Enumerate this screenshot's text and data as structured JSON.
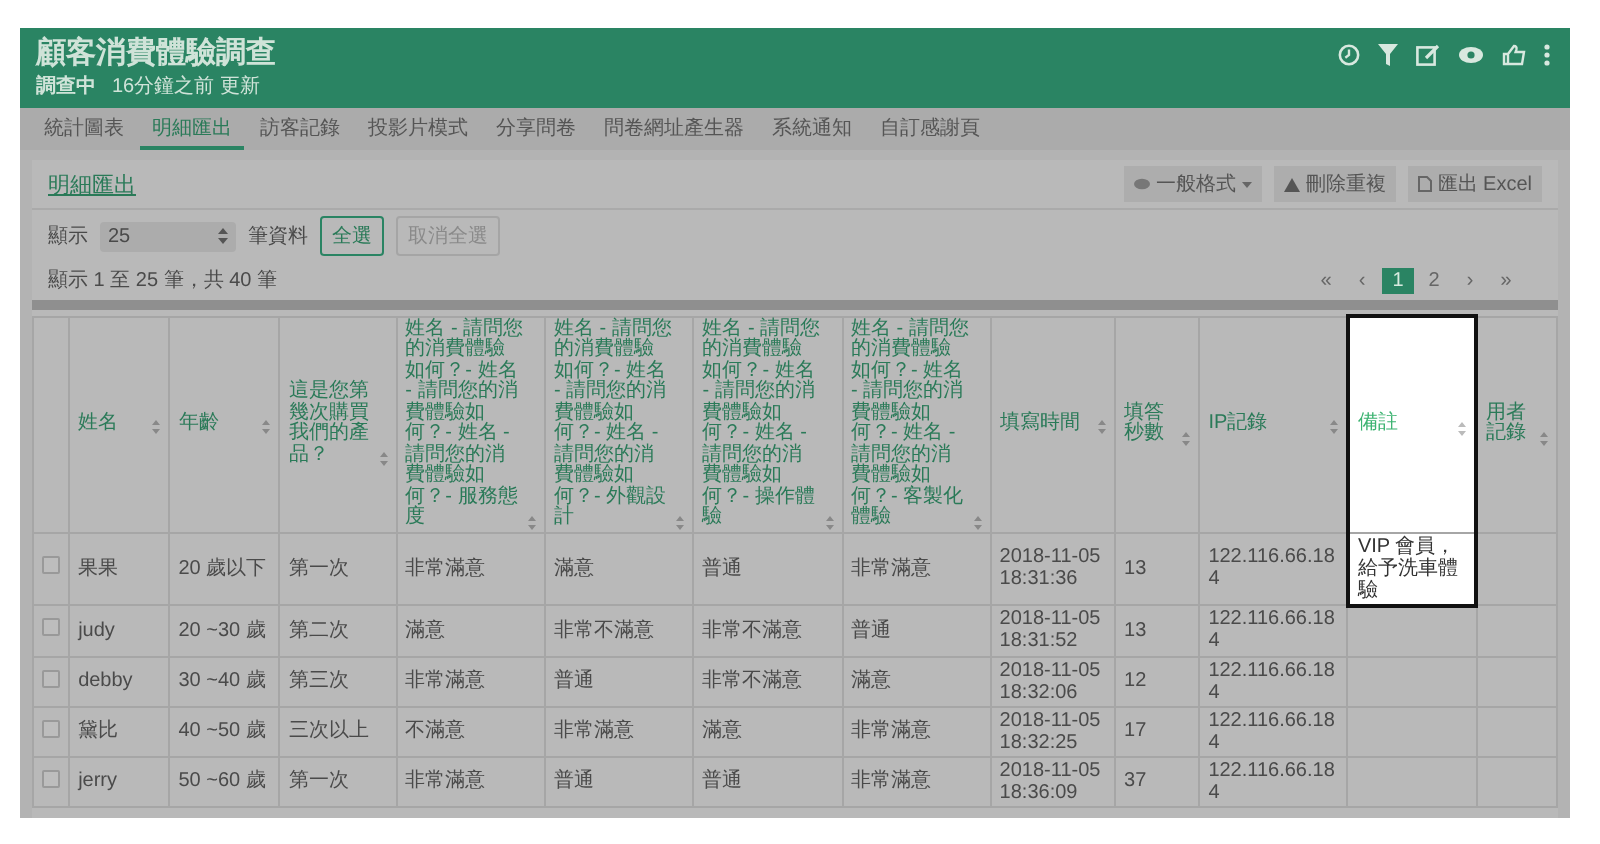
{
  "header": {
    "title": "顧客消費體驗調查",
    "status": "調查中",
    "updated": "16分鐘之前 更新"
  },
  "tabs": [
    {
      "label": "統計圖表",
      "selected": false
    },
    {
      "label": "明細匯出",
      "selected": true
    },
    {
      "label": "訪客記錄",
      "selected": false
    },
    {
      "label": "投影片模式",
      "selected": false
    },
    {
      "label": "分享問卷",
      "selected": false
    },
    {
      "label": "問卷網址產生器",
      "selected": false
    },
    {
      "label": "系統通知",
      "selected": false
    },
    {
      "label": "自訂感謝頁",
      "selected": false
    }
  ],
  "panel": {
    "title": "明細匯出",
    "tools": [
      {
        "kind": "format",
        "label": "一般格式"
      },
      {
        "kind": "dedupe",
        "label": "刪除重複"
      },
      {
        "kind": "export",
        "label": "匯出 Excel"
      }
    ]
  },
  "controls": {
    "show_label": "顯示",
    "page_size": "25",
    "unit_label": "筆資料",
    "buttons": [
      {
        "label": "全選",
        "disabled": false
      },
      {
        "label": "取消全選",
        "disabled": true
      }
    ]
  },
  "info": "顯示 1 至 25 筆，共 40 筆",
  "pagination": [
    {
      "label": "«",
      "selected": false
    },
    {
      "label": "‹",
      "selected": false
    },
    {
      "label": "1",
      "selected": true
    },
    {
      "label": "2",
      "selected": false
    },
    {
      "label": "›",
      "selected": false
    },
    {
      "label": "»",
      "selected": false
    }
  ],
  "table": {
    "columns": [
      {
        "label": "姓名",
        "highlighted": false
      },
      {
        "label": "年齡",
        "highlighted": false
      },
      {
        "label": "這是您第幾次購買我們的產品？",
        "highlighted": false
      },
      {
        "label": "姓名 - 請問您的消費體驗如何？- 姓名 - 請問您的消費體驗如何？- 姓名 - 請問您的消費體驗如何？- 服務態度",
        "highlighted": false
      },
      {
        "label": "姓名 - 請問您的消費體驗如何？- 姓名 - 請問您的消費體驗如何？- 姓名 - 請問您的消費體驗如何？- 外觀設計",
        "highlighted": false
      },
      {
        "label": "姓名 - 請問您的消費體驗如何？- 姓名 - 請問您的消費體驗如何？- 姓名 - 請問您的消費體驗如何？- 操作體驗",
        "highlighted": false
      },
      {
        "label": "姓名 - 請問您的消費體驗如何？- 姓名 - 請問您的消費體驗如何？- 姓名 - 請問您的消費體驗如何？- 客製化體驗",
        "highlighted": false
      },
      {
        "label": "填寫時間",
        "highlighted": false
      },
      {
        "label": "填答秒數",
        "highlighted": false
      },
      {
        "label": "IP記錄",
        "highlighted": false
      },
      {
        "label": "備註",
        "highlighted": true
      },
      {
        "label": "用者記錄",
        "highlighted": false
      }
    ],
    "rows": [
      {
        "checked": false,
        "cells": [
          "果果",
          "20 歲以下",
          "第一次",
          "非常滿意",
          "滿意",
          "普通",
          "非常滿意",
          "2018-11-05 18:31:36",
          "13",
          "122.116.66.184",
          "VIP 會員，給予洗車體驗",
          ""
        ]
      },
      {
        "checked": false,
        "cells": [
          "judy",
          "20 ~30 歲",
          "第二次",
          "滿意",
          "非常不滿意",
          "非常不滿意",
          "普通",
          "2018-11-05 18:31:52",
          "13",
          "122.116.66.184",
          "",
          ""
        ]
      },
      {
        "checked": false,
        "cells": [
          "debby",
          "30 ~40 歲",
          "第三次",
          "非常滿意",
          "普通",
          "非常不滿意",
          "滿意",
          "2018-11-05 18:32:06",
          "12",
          "122.116.66.184",
          "",
          ""
        ]
      },
      {
        "checked": false,
        "cells": [
          "黛比",
          "40 ~50 歲",
          "三次以上",
          "不滿意",
          "非常滿意",
          "滿意",
          "非常滿意",
          "2018-11-05 18:32:25",
          "17",
          "122.116.66.184",
          "",
          ""
        ]
      },
      {
        "checked": false,
        "cells": [
          "jerry",
          "50 ~60 歲",
          "第一次",
          "非常滿意",
          "普通",
          "普通",
          "非常滿意",
          "2018-11-05 18:36:09",
          "37",
          "122.116.66.184",
          "",
          ""
        ]
      }
    ]
  }
}
